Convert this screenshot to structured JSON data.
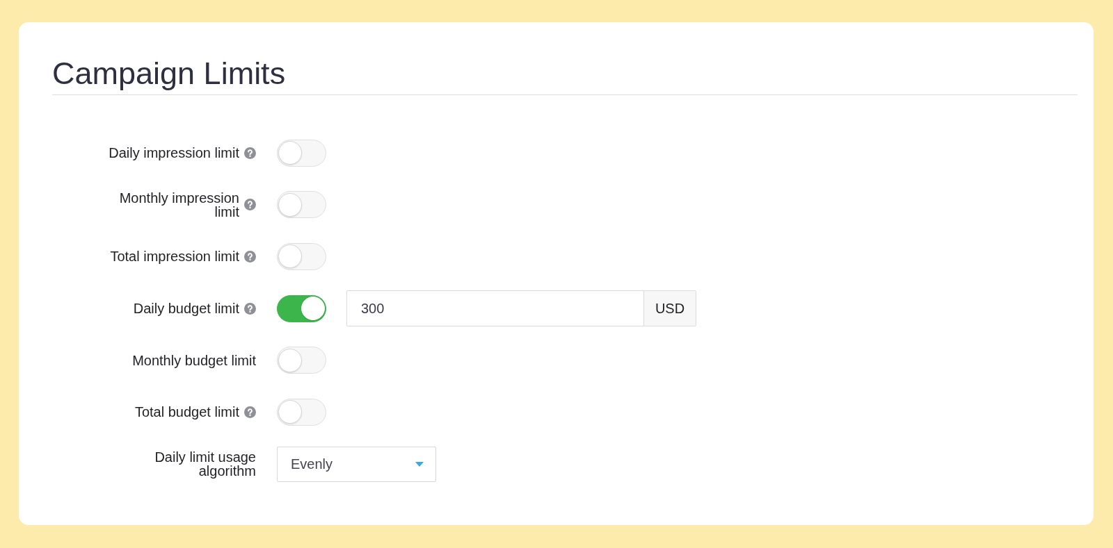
{
  "title": "Campaign Limits",
  "fields": [
    {
      "kind": "toggle",
      "label": "Daily impression limit",
      "help": true,
      "on": false
    },
    {
      "kind": "toggle",
      "label": "Monthly impression limit",
      "help": true,
      "on": false
    },
    {
      "kind": "toggle",
      "label": "Total impression limit",
      "help": true,
      "on": false
    },
    {
      "kind": "toggle",
      "label": "Daily budget limit",
      "help": true,
      "on": true,
      "input": {
        "value": "300",
        "unit": "USD"
      }
    },
    {
      "kind": "toggle",
      "label": "Monthly budget limit",
      "help": false,
      "on": false
    },
    {
      "kind": "toggle",
      "label": "Total budget limit",
      "help": true,
      "on": false
    },
    {
      "kind": "select",
      "label": "Daily limit usage algorithm",
      "help": false,
      "value": "Evenly"
    }
  ]
}
